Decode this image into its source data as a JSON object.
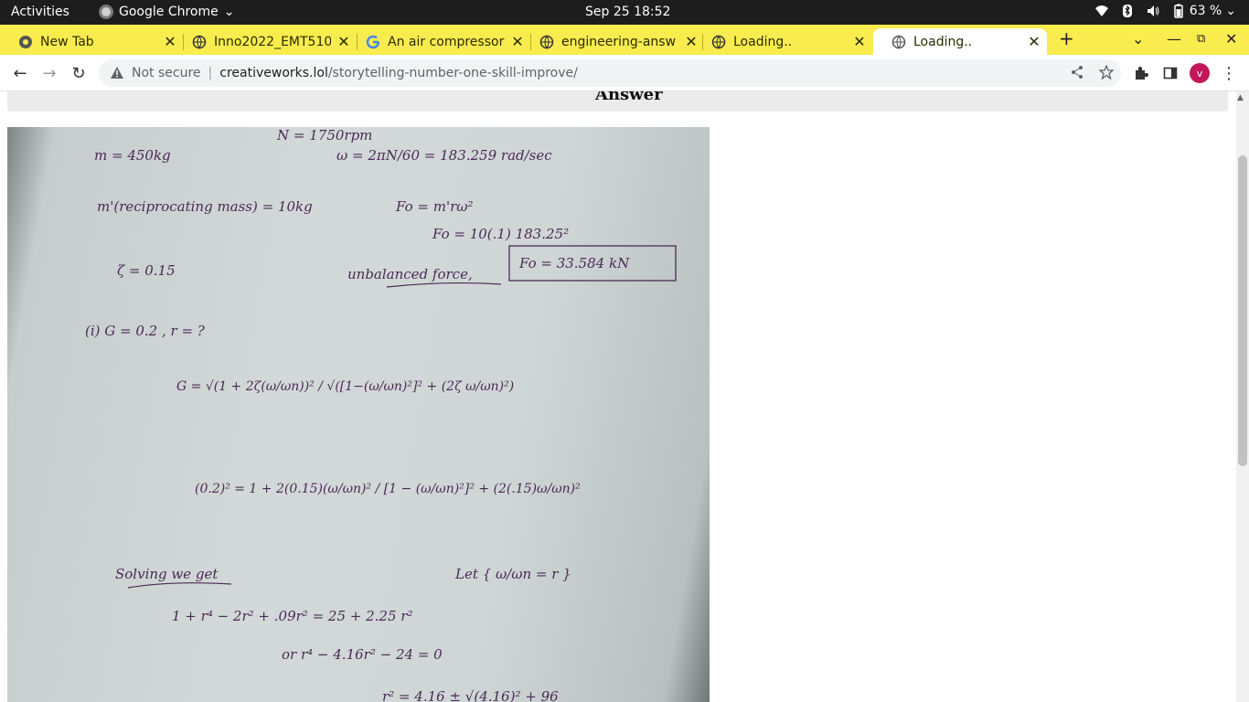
{
  "system_bar": {
    "activities": "Activities",
    "app_name": "Google Chrome",
    "clock": "Sep 25  18:52",
    "battery": "63 %"
  },
  "tabs": [
    {
      "title": "New Tab",
      "icon": "chrome-icon",
      "active": false
    },
    {
      "title": "Inno2022_EMT510",
      "icon": "globe-icon",
      "active": false
    },
    {
      "title": "An air compressor",
      "icon": "google-icon",
      "active": false
    },
    {
      "title": "engineering-answ",
      "icon": "globe-icon",
      "active": false
    },
    {
      "title": "Loading..",
      "icon": "globe-icon",
      "active": false
    },
    {
      "title": "Loading..",
      "icon": "globe-icon",
      "active": true
    }
  ],
  "toolbar": {
    "security_label": "Not secure",
    "url_domain": "creativeworks.lol",
    "url_path": "/storytelling-number-one-skill-improve/",
    "profile_initial": "v"
  },
  "page": {
    "section_heading": "Answer"
  },
  "handwriting": {
    "l1a": "m = 450kg",
    "l1b": "N = 1750rpm",
    "l1c": "ω = 2πN/60 = 183.259 rad/sec",
    "l2a": "m'(reciprocating mass) = 10kg",
    "l2b": "Fo = m'rω²",
    "l3": "Fo = 10(.1) 183.25²",
    "l4a": "ζ = 0.15",
    "l4b": "unbalanced force,",
    "l4c": "Fo = 33.584 kN",
    "l5": "(i)  G = 0.2 ,  r = ?",
    "l6": "G = √(1 + 2ζ(ω/ωn))² / √([1−(ω/ωn)²]² + (2ζ ω/ωn)²)",
    "l7": "(0.2)² = 1 + 2(0.15)(ω/ωn)² / [1 − (ω/ωn)²]² + (2(.15)ω/ωn)²",
    "l8a": "Solving we get",
    "l8b": "Let  { ω/ωn = r }",
    "l9": "1 + r⁴ − 2r² + .09r² = 25 + 2.25 r²",
    "l10": "or     r⁴ − 4.16r² − 24 = 0",
    "l11": "r² = 4.16 ± √(4.16)² + 96"
  }
}
